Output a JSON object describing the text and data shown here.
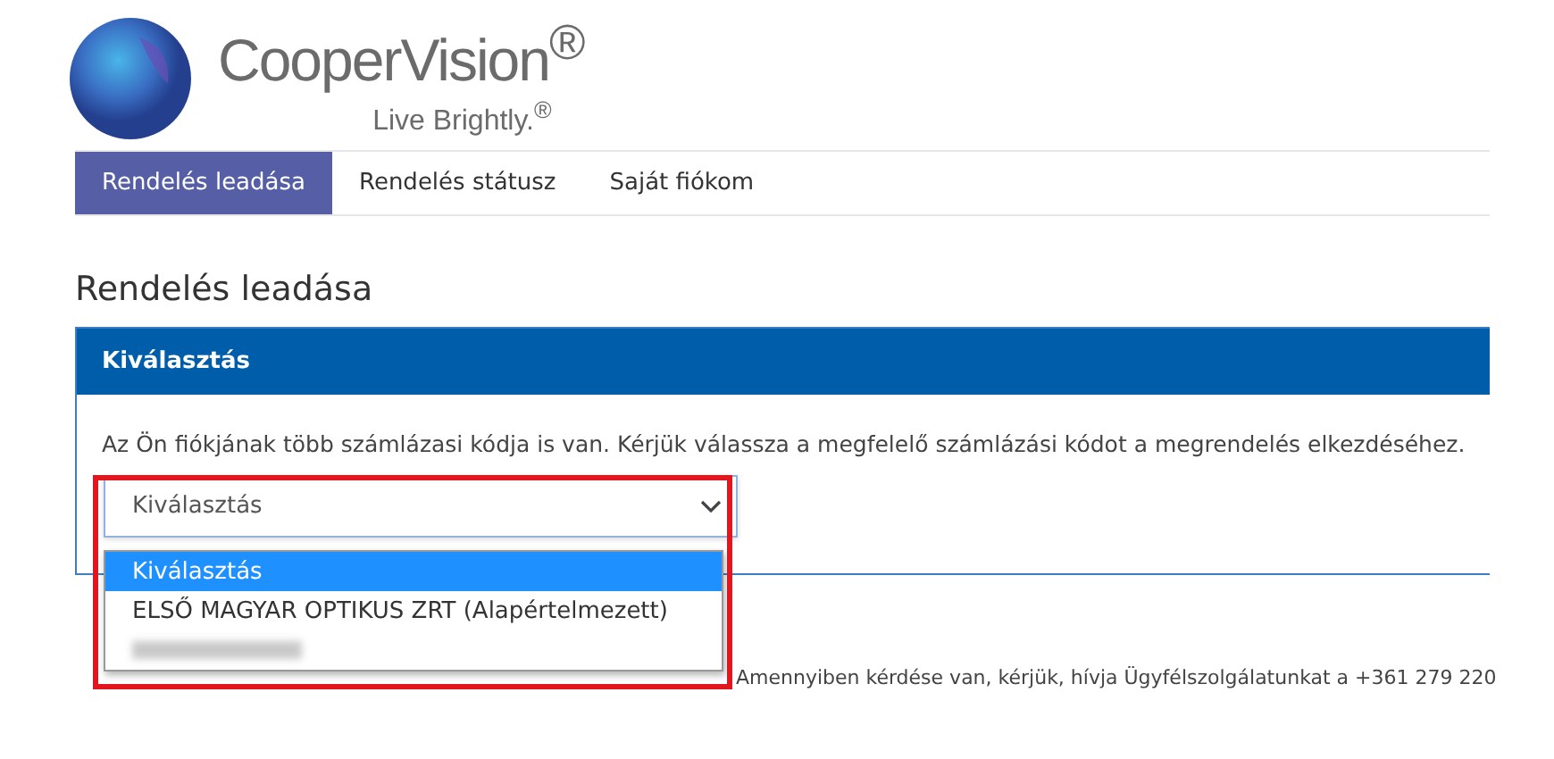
{
  "brand": {
    "name": "CooperVision",
    "mark": "®",
    "tagline": "Live Brightly.",
    "tagline_mark": "®"
  },
  "nav": [
    {
      "label": "Rendelés leadása",
      "selected": true
    },
    {
      "label": "Rendelés státusz",
      "selected": false
    },
    {
      "label": "Saját fiókom",
      "selected": false
    }
  ],
  "page_title": "Rendelés leadása",
  "panel": {
    "title": "Kiválasztás",
    "message": "Az Ön fiókjának több számlázasi kódja is van. Kérjük válassza a megfelelő számlázási kódot a megrendelés elkezdéséhez.",
    "select": {
      "value": "Kiválasztás",
      "expanded": true,
      "highlighted": true,
      "options": [
        {
          "label": "Kiválasztás",
          "selected": true,
          "kind": "text"
        },
        {
          "label": "ELSŐ MAGYAR OPTIKUS ZRT (Alapértelmezett)",
          "selected": false,
          "kind": "text"
        },
        {
          "kind": "redacted",
          "selected": false
        }
      ]
    }
  },
  "footer_note": "Amennyiben kérdése van, kérjük, hívja Ügyfélszolgálatunkat a +361 279 220"
}
